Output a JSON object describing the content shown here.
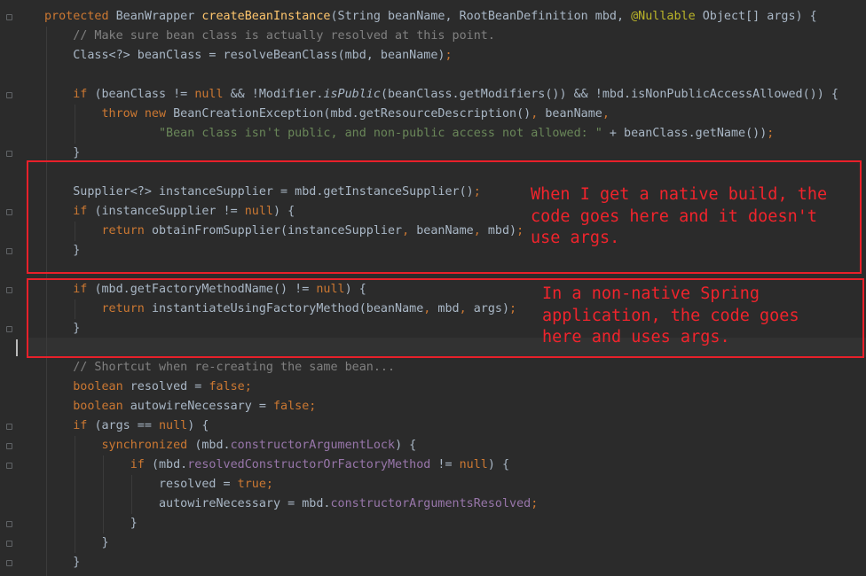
{
  "editor": {
    "lines": [
      [
        [
          "kw",
          "protected "
        ],
        [
          "p",
          "BeanWrapper "
        ],
        [
          "fn",
          "createBeanInstance"
        ],
        [
          "p",
          "(String beanName, RootBeanDefinition mbd, "
        ],
        [
          "an",
          "@Nullable"
        ],
        [
          "p",
          " Object[] args) {"
        ]
      ],
      [
        [
          "p",
          "    "
        ],
        [
          "cm",
          "// Make sure bean class is actually resolved at this point."
        ]
      ],
      [
        [
          "p",
          "    Class<?> beanClass = resolveBeanClass(mbd, beanName)"
        ],
        [
          "kw",
          ";"
        ]
      ],
      [],
      [
        [
          "p",
          "    "
        ],
        [
          "kw",
          "if "
        ],
        [
          "p",
          "(beanClass != "
        ],
        [
          "kw",
          "null "
        ],
        [
          "p",
          "&& !Modifier."
        ],
        [
          "it",
          "isPublic"
        ],
        [
          "p",
          "(beanClass.getModifiers()) && !mbd.isNonPublicAccessAllowed()) {"
        ]
      ],
      [
        [
          "p",
          "        "
        ],
        [
          "kw",
          "throw new "
        ],
        [
          "p",
          "BeanCreationException(mbd.getResourceDescription()"
        ],
        [
          "kw",
          ", "
        ],
        [
          "p",
          "beanName"
        ],
        [
          "kw",
          ","
        ]
      ],
      [
        [
          "p",
          "                "
        ],
        [
          "str",
          "\"Bean class isn't public, and non-public access not allowed: \""
        ],
        [
          "p",
          " + beanClass.getName())"
        ],
        [
          "kw",
          ";"
        ]
      ],
      [
        [
          "p",
          "    }"
        ]
      ],
      [],
      [
        [
          "p",
          "    Supplier<?> instanceSupplier = mbd.getInstanceSupplier()"
        ],
        [
          "kw",
          ";"
        ]
      ],
      [
        [
          "p",
          "    "
        ],
        [
          "kw",
          "if "
        ],
        [
          "p",
          "(instanceSupplier != "
        ],
        [
          "kw",
          "null"
        ],
        [
          "p",
          ") {"
        ]
      ],
      [
        [
          "p",
          "        "
        ],
        [
          "kw",
          "return "
        ],
        [
          "p",
          "obtainFromSupplier(instanceSupplier"
        ],
        [
          "kw",
          ", "
        ],
        [
          "p",
          "beanName"
        ],
        [
          "kw",
          ", "
        ],
        [
          "p",
          "mbd)"
        ],
        [
          "kw",
          ";"
        ]
      ],
      [
        [
          "p",
          "    }"
        ]
      ],
      [],
      [
        [
          "p",
          "    "
        ],
        [
          "kw",
          "if "
        ],
        [
          "p",
          "(mbd.getFactoryMethodName() != "
        ],
        [
          "kw",
          "null"
        ],
        [
          "p",
          ") {"
        ]
      ],
      [
        [
          "p",
          "        "
        ],
        [
          "kw",
          "return "
        ],
        [
          "p",
          "instantiateUsingFactoryMethod(beanName"
        ],
        [
          "kw",
          ", "
        ],
        [
          "p",
          "mbd"
        ],
        [
          "kw",
          ", "
        ],
        [
          "p",
          "args)"
        ],
        [
          "kw",
          ";"
        ]
      ],
      [
        [
          "p",
          "    }"
        ]
      ],
      [],
      [
        [
          "p",
          "    "
        ],
        [
          "cm",
          "// Shortcut when re-creating the same bean..."
        ]
      ],
      [
        [
          "p",
          "    "
        ],
        [
          "kw",
          "boolean "
        ],
        [
          "p",
          "resolved = "
        ],
        [
          "kw",
          "false;"
        ]
      ],
      [
        [
          "p",
          "    "
        ],
        [
          "kw",
          "boolean "
        ],
        [
          "p",
          "autowireNecessary = "
        ],
        [
          "kw",
          "false;"
        ]
      ],
      [
        [
          "p",
          "    "
        ],
        [
          "kw",
          "if "
        ],
        [
          "p",
          "(args == "
        ],
        [
          "kw",
          "null"
        ],
        [
          "p",
          ") {"
        ]
      ],
      [
        [
          "p",
          "        "
        ],
        [
          "kw",
          "synchronized "
        ],
        [
          "p",
          "(mbd."
        ],
        [
          "fld",
          "constructorArgumentLock"
        ],
        [
          "p",
          ") {"
        ]
      ],
      [
        [
          "p",
          "            "
        ],
        [
          "kw",
          "if "
        ],
        [
          "p",
          "(mbd."
        ],
        [
          "fld",
          "resolvedConstructorOrFactoryMethod"
        ],
        [
          "p",
          " != "
        ],
        [
          "kw",
          "null"
        ],
        [
          "p",
          ") {"
        ]
      ],
      [
        [
          "p",
          "                resolved = "
        ],
        [
          "kw",
          "true;"
        ]
      ],
      [
        [
          "p",
          "                autowireNecessary = mbd."
        ],
        [
          "fld",
          "constructorArgumentsResolved"
        ],
        [
          "kw",
          ";"
        ]
      ],
      [
        [
          "p",
          "            }"
        ]
      ],
      [
        [
          "p",
          "        }"
        ]
      ],
      [
        [
          "p",
          "    }"
        ]
      ]
    ]
  },
  "annotations": {
    "native_note": "When I get a native build, the\ncode goes here and it doesn't\nuse args.",
    "nonnative_note": "In a non-native Spring\napplication, the code goes\nhere and uses args."
  },
  "colors": {
    "background": "#2b2b2b",
    "keyword": "#cc7832",
    "method_declaration": "#ffc66d",
    "string": "#6a8759",
    "comment": "#808080",
    "annotation": "#bbb529",
    "field": "#9876aa",
    "annotation_box": "#e8202a"
  }
}
